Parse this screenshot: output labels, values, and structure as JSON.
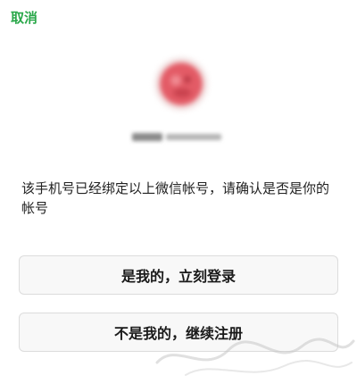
{
  "header": {
    "cancel_label": "取消"
  },
  "account": {
    "avatar_icon": "user-avatar-icon",
    "avatar_color": "#e35b66"
  },
  "dialog": {
    "message": "该手机号已经绑定以上微信帐号，请确认是否是你的帐号"
  },
  "actions": {
    "confirm_label": "是我的，立刻登录",
    "not_me_label": "不是我的，继续注册"
  },
  "theme": {
    "accent": "#2aa84a"
  }
}
